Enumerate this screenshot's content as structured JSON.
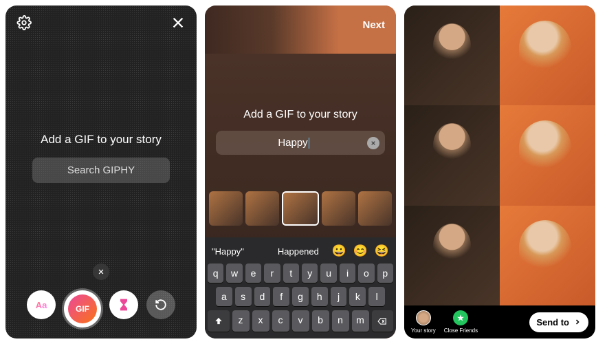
{
  "screen1": {
    "title": "Add a GIF to your story",
    "search_placeholder": "Search GIPHY",
    "tray": {
      "aa": "Aa",
      "gif": "GIF"
    }
  },
  "screen2": {
    "next_label": "Next",
    "title": "Add a GIF to your story",
    "search_value": "Happy",
    "suggestions": {
      "s1": "\"Happy\"",
      "s2": "Happened",
      "e1": "😀",
      "e2": "😊",
      "e3": "😆"
    },
    "keyboard": {
      "row1": [
        "q",
        "w",
        "e",
        "r",
        "t",
        "y",
        "u",
        "i",
        "o",
        "p"
      ],
      "row2": [
        "a",
        "s",
        "d",
        "f",
        "g",
        "h",
        "j",
        "k",
        "l"
      ],
      "row3": [
        "z",
        "x",
        "c",
        "v",
        "b",
        "n",
        "m"
      ]
    }
  },
  "screen3": {
    "your_story": "Your story",
    "close_friends": "Close Friends",
    "send_to": "Send to"
  }
}
